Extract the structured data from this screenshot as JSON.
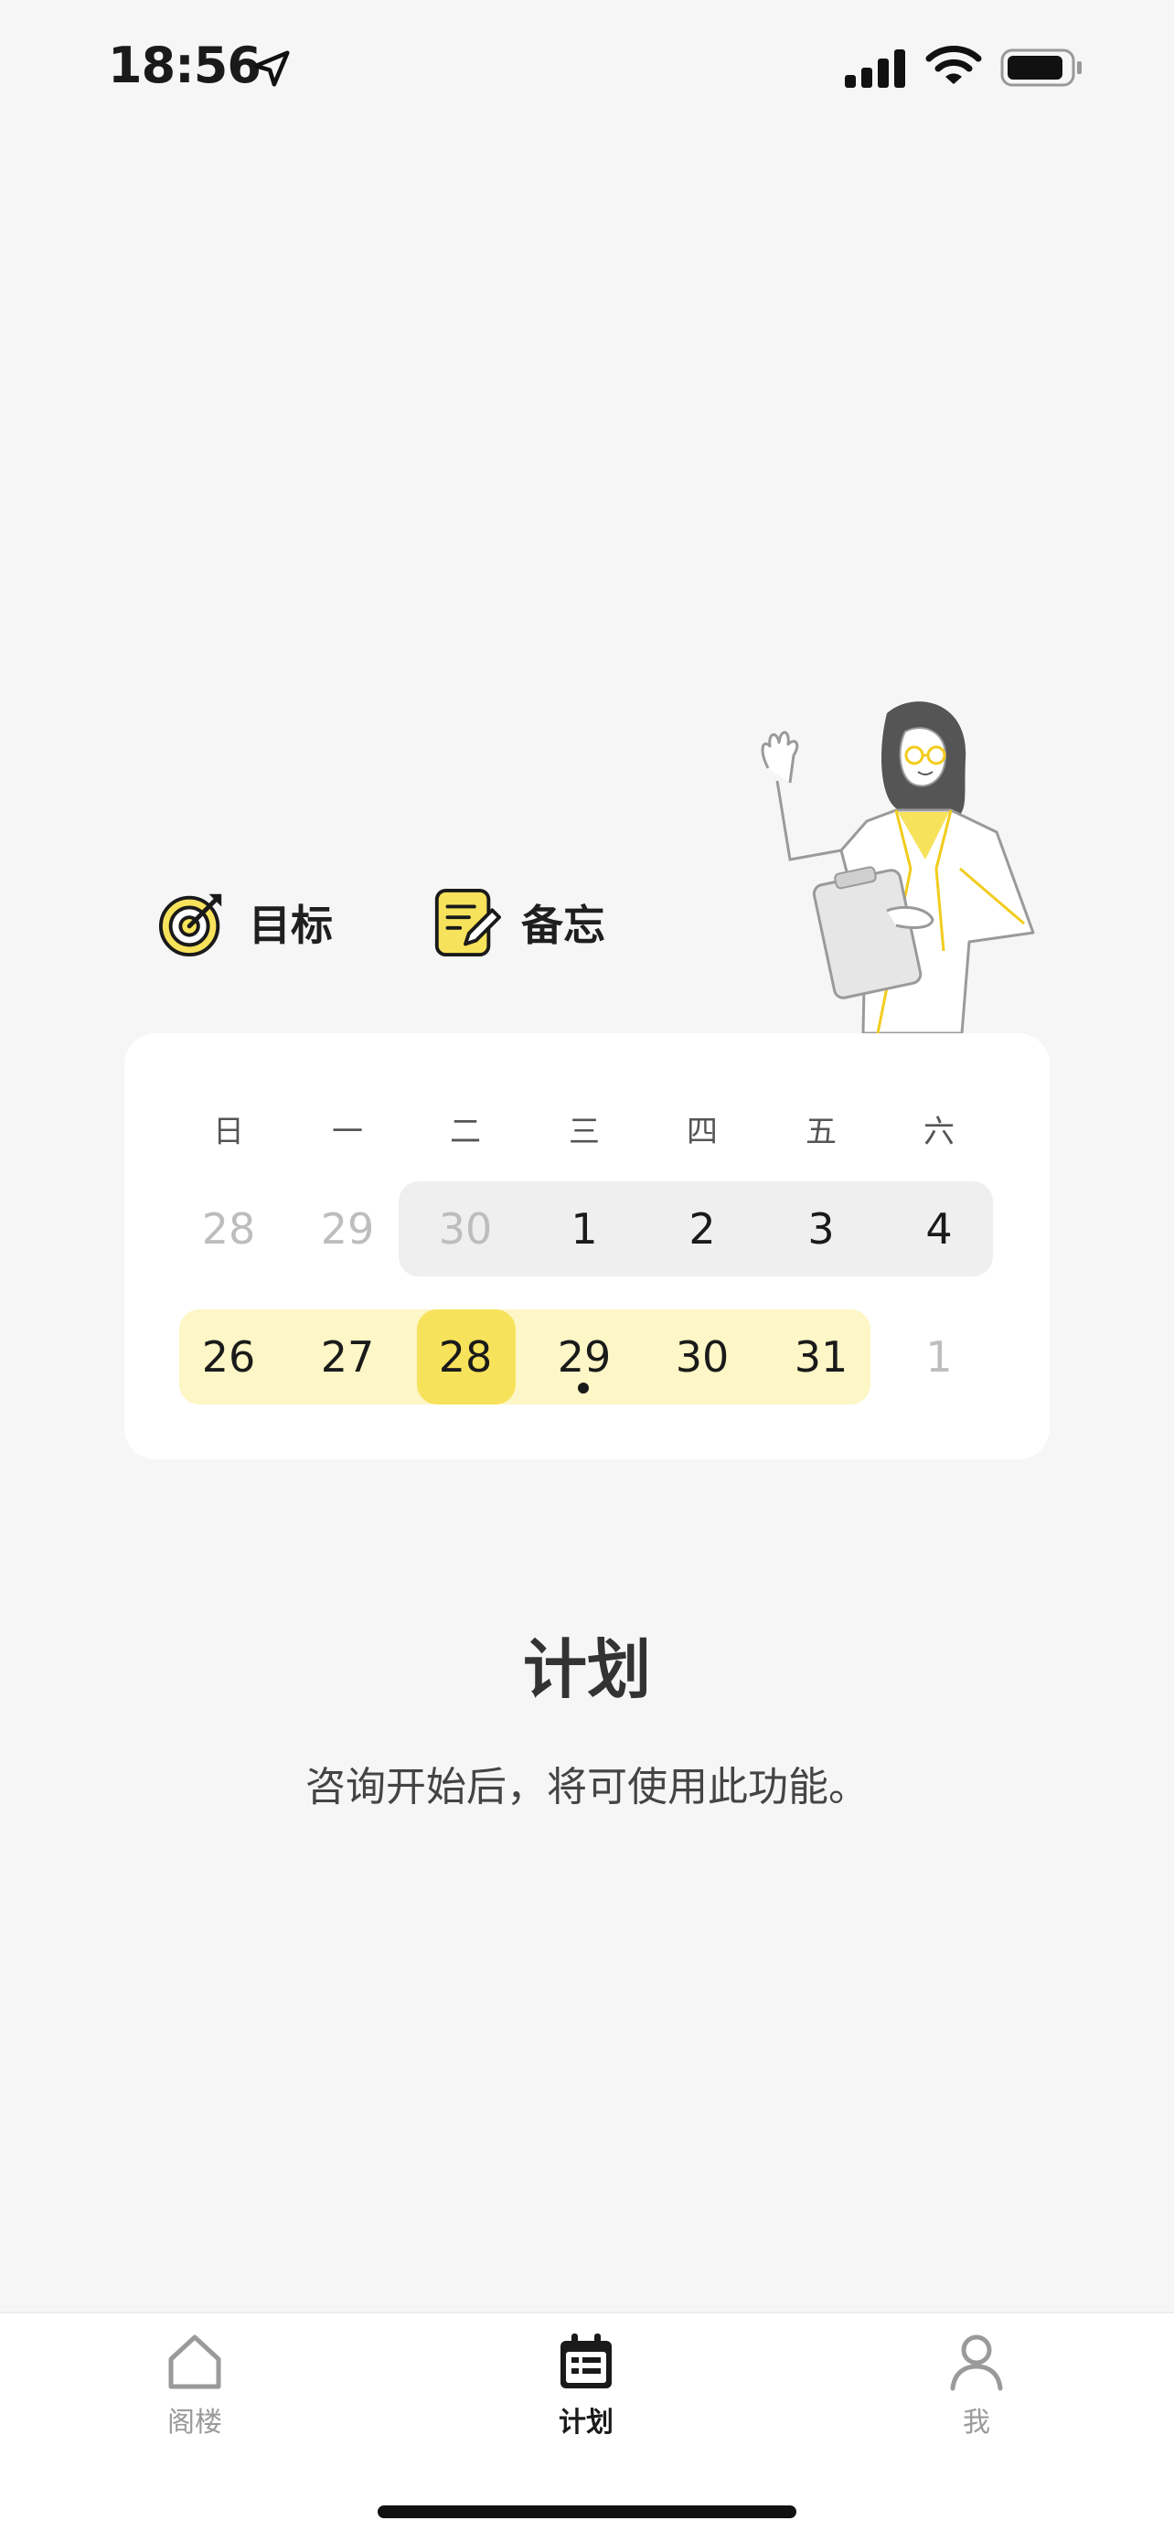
{
  "status_bar": {
    "time": "18:56",
    "icons": [
      "location-arrow-icon",
      "signal-icon",
      "wifi-icon",
      "battery-icon"
    ]
  },
  "shortcuts": {
    "goals_label": "目标",
    "memo_label": "备忘"
  },
  "calendar": {
    "weekdays": [
      "日",
      "一",
      "二",
      "三",
      "四",
      "五",
      "六"
    ],
    "week1": [
      "28",
      "29",
      "30",
      "1",
      "2",
      "3",
      "4"
    ],
    "week2": [
      "26",
      "27",
      "28",
      "29",
      "30",
      "31",
      "1"
    ],
    "selected_day": "28"
  },
  "empty_state": {
    "title": "计划",
    "description": "咨询开始后，将可使用此功能。"
  },
  "tab_bar": {
    "home_label": "阁楼",
    "plan_label": "计划",
    "me_label": "我",
    "active_tab": "计划"
  },
  "colors": {
    "accent_yellow": "#f7e25b",
    "week_highlight": "#fdf6c6",
    "background": "#f6f6f6"
  }
}
